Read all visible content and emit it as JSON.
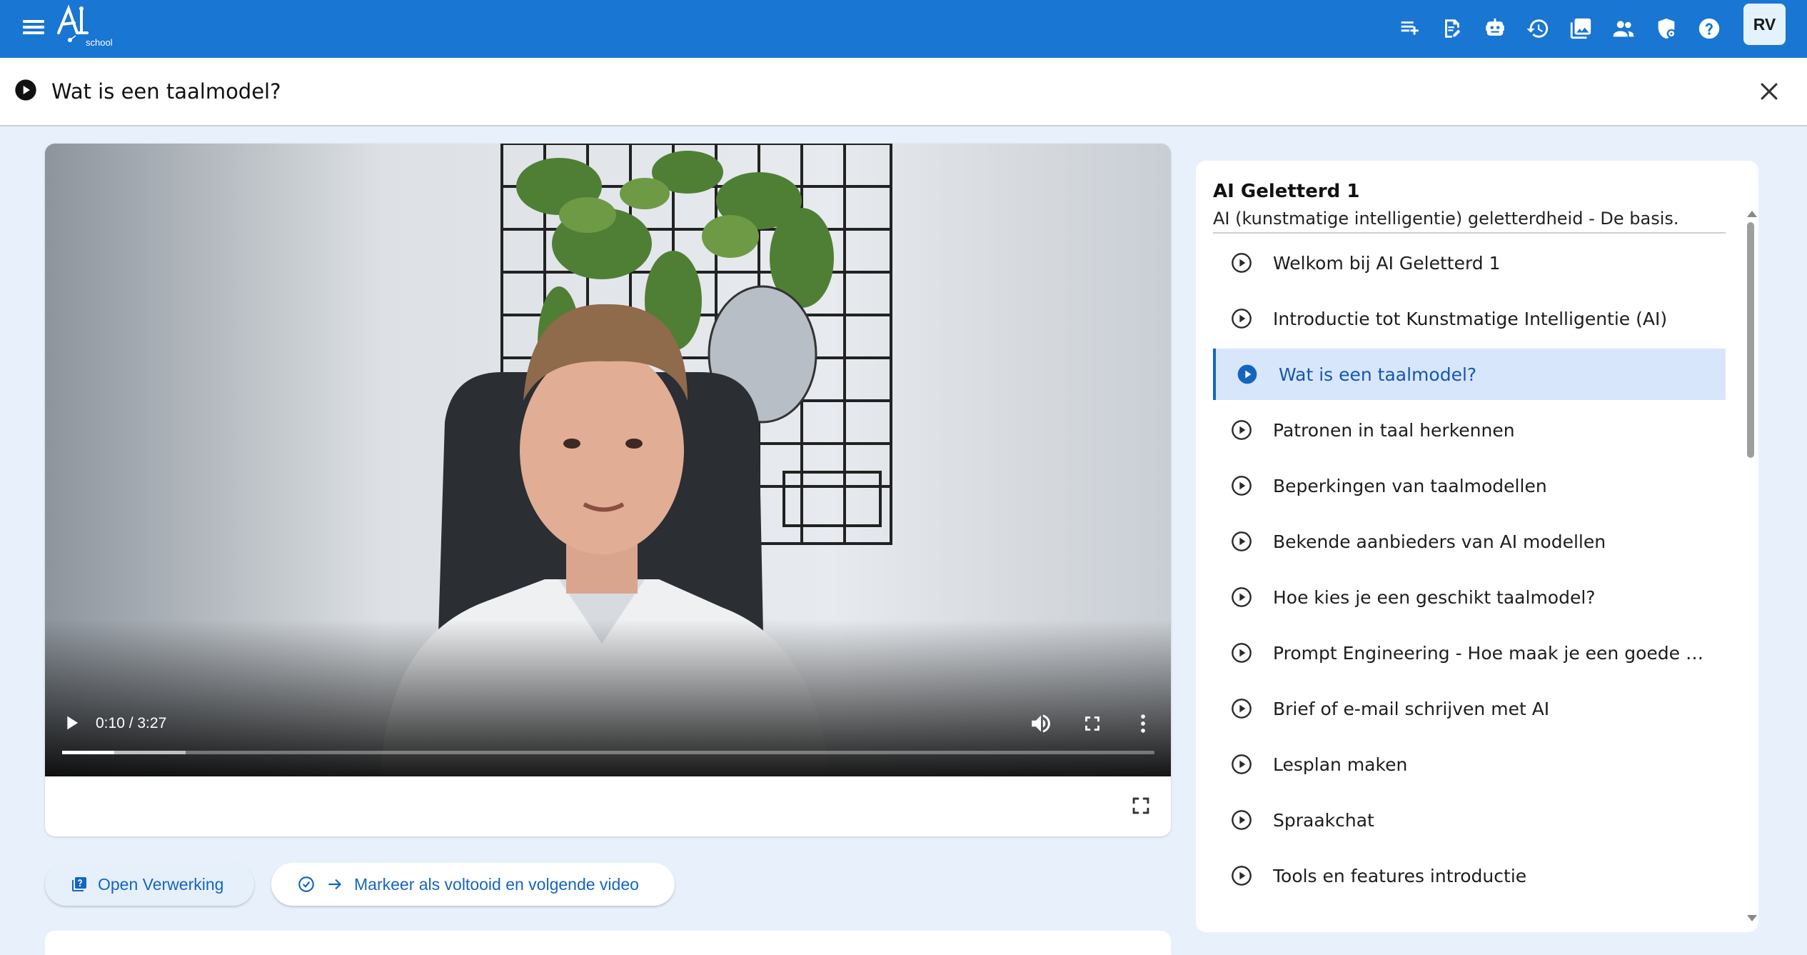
{
  "header": {
    "logo_text": "AI",
    "logo_sub": "school",
    "icons": [
      "playlist-add-icon",
      "assignment-edit-icon",
      "robot-icon",
      "history-icon",
      "photo-library-icon",
      "people-icon",
      "shield-gear-icon",
      "help-icon"
    ],
    "avatar_initials": "RV",
    "accent_color": "#1976d2"
  },
  "title_bar": {
    "title": "Wat is een taalmodel?"
  },
  "video": {
    "time": "0:10 / 3:27",
    "progress_fraction": 0.048,
    "buffered_fraction": 0.113
  },
  "actions": {
    "open_label": "Open Verwerking",
    "mark_label": "Markeer als voltooid en volgende video"
  },
  "sidebar": {
    "course_title": "AI Geletterd 1",
    "course_subtitle": "AI (kunstmatige intelligentie) geletterdheid - De basis.",
    "lessons": [
      {
        "label": "Welkom bij AI Geletterd 1"
      },
      {
        "label": "Introductie tot Kunstmatige Intelligentie (AI)"
      },
      {
        "label": "Wat is een taalmodel?",
        "active": true
      },
      {
        "label": "Patronen in taal herkennen"
      },
      {
        "label": "Beperkingen van taalmodellen"
      },
      {
        "label": "Bekende aanbieders van AI modellen"
      },
      {
        "label": "Hoe kies je een geschikt taalmodel?"
      },
      {
        "label": "Prompt Engineering - Hoe maak je een goede …"
      },
      {
        "label": "Brief of e-mail schrijven met AI"
      },
      {
        "label": "Lesplan maken"
      },
      {
        "label": "Spraakchat"
      },
      {
        "label": "Tools en features introductie"
      }
    ]
  }
}
